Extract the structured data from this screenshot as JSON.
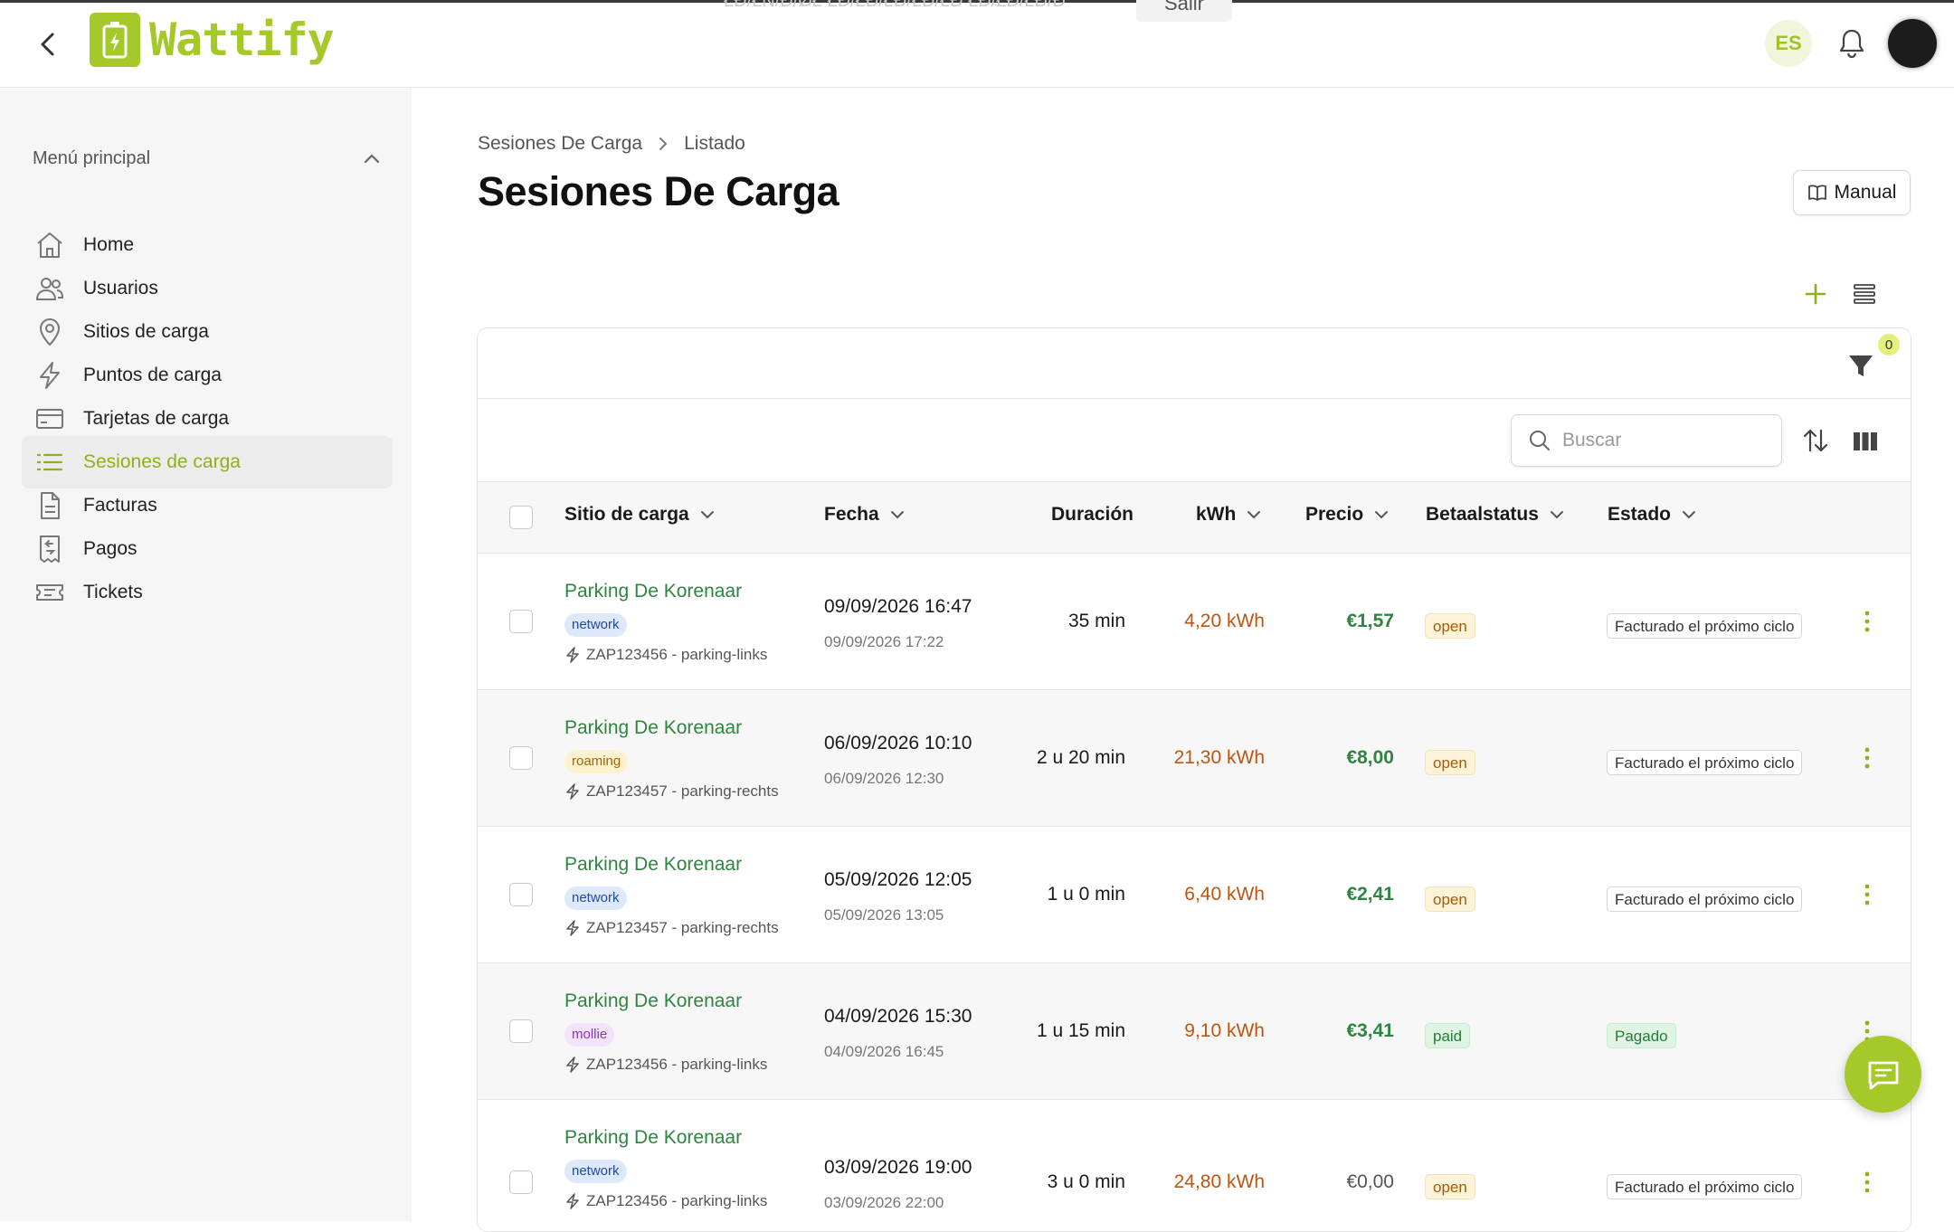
{
  "app": {
    "name": "Wattify",
    "accent": "#a6c92a"
  },
  "topbar": {
    "overlay_text": "ŁÐ/ŁN/Ð/ØŁ ŁÐ/ŁÐ/ŁÐ/ŁÐ/ŁÐ ŁÐ/ŁÐ/ŁÐ/Ð",
    "overlay_button": "Salir",
    "language": "ES"
  },
  "sidebar": {
    "heading": "Menú principal",
    "items": [
      {
        "label": "Home",
        "icon": "home-icon"
      },
      {
        "label": "Usuarios",
        "icon": "users-icon"
      },
      {
        "label": "Sitios de carga",
        "icon": "map-pin-icon"
      },
      {
        "label": "Puntos de carga",
        "icon": "bolt-icon"
      },
      {
        "label": "Tarjetas de carga",
        "icon": "card-icon"
      },
      {
        "label": "Sesiones de carga",
        "icon": "list-icon",
        "active": true
      },
      {
        "label": "Facturas",
        "icon": "document-icon"
      },
      {
        "label": "Pagos",
        "icon": "receipt-icon"
      },
      {
        "label": "Tickets",
        "icon": "ticket-icon"
      }
    ]
  },
  "breadcrumb": {
    "parent": "Sesiones De Carga",
    "current": "Listado"
  },
  "page": {
    "title": "Sesiones De Carga",
    "manual_label": "Manual"
  },
  "filters": {
    "count": "0"
  },
  "search": {
    "placeholder": "Buscar"
  },
  "table": {
    "columns": {
      "site": "Sitio de carga",
      "date": "Fecha",
      "duration": "Duración",
      "kwh": "kWh",
      "price": "Precio",
      "payment_status": "Betaalstatus",
      "status": "Estado"
    },
    "rows": [
      {
        "site": "Parking De Korenaar",
        "tag": "network",
        "charge_point": "ZAP123456 - parking-links",
        "start": "09/09/2026 16:47",
        "end": "09/09/2026 17:22",
        "duration": "35 min",
        "kwh": "4,20 kWh",
        "price": "€1,57",
        "payment": "open",
        "status": "Facturado el próximo ciclo"
      },
      {
        "site": "Parking De Korenaar",
        "tag": "roaming",
        "charge_point": "ZAP123457 - parking-rechts",
        "start": "06/09/2026 10:10",
        "end": "06/09/2026 12:30",
        "duration": "2 u 20 min",
        "kwh": "21,30 kWh",
        "price": "€8,00",
        "payment": "open",
        "status": "Facturado el próximo ciclo"
      },
      {
        "site": "Parking De Korenaar",
        "tag": "network",
        "charge_point": "ZAP123457 - parking-rechts",
        "start": "05/09/2026 12:05",
        "end": "05/09/2026 13:05",
        "duration": "1 u 0 min",
        "kwh": "6,40 kWh",
        "price": "€2,41",
        "payment": "open",
        "status": "Facturado el próximo ciclo"
      },
      {
        "site": "Parking De Korenaar",
        "tag": "mollie",
        "charge_point": "ZAP123456 - parking-links",
        "start": "04/09/2026 15:30",
        "end": "04/09/2026 16:45",
        "duration": "1 u 15 min",
        "kwh": "9,10 kWh",
        "price": "€3,41",
        "payment": "paid",
        "status": "Pagado"
      },
      {
        "site": "Parking De Korenaar",
        "tag": "network",
        "charge_point": "ZAP123456 - parking-links",
        "start": "03/09/2026 19:00",
        "end": "03/09/2026 22:00",
        "duration": "3 u 0 min",
        "kwh": "24,80 kWh",
        "price": "€0,00",
        "payment": "open",
        "status": "Facturado el próximo ciclo"
      }
    ]
  }
}
